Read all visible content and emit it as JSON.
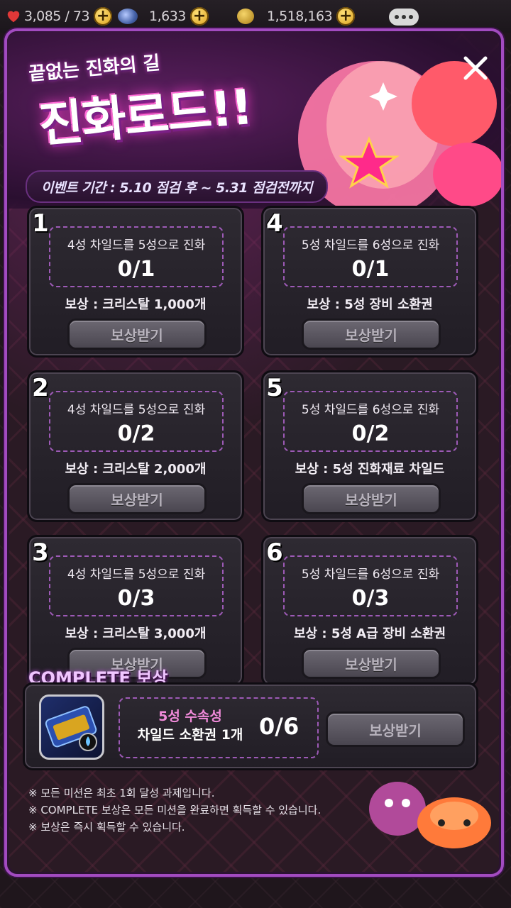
{
  "topbar": {
    "hearts": "3,085 / 73",
    "gems": "1,633",
    "gold": "1,518,163"
  },
  "banner": {
    "subtitle": "끝없는 진화의 길",
    "title": "진화로드!!",
    "period": "이벤트 기간 : 5.10 점검 후 ~ 5.31 점검전까지"
  },
  "missions": [
    {
      "num": "1",
      "desc": "4성 차일드를 5성으로 진화",
      "progress": "0/1",
      "reward": "보상 :  크리스탈 1,000개",
      "button": "보상받기"
    },
    {
      "num": "2",
      "desc": "4성 차일드를 5성으로 진화",
      "progress": "0/2",
      "reward": "보상 :  크리스탈 2,000개",
      "button": "보상받기"
    },
    {
      "num": "3",
      "desc": "4성 차일드를 5성으로 진화",
      "progress": "0/3",
      "reward": "보상 :  크리스탈 3,000개",
      "button": "보상받기"
    },
    {
      "num": "4",
      "desc": "5성 차일드를 6성으로 진화",
      "progress": "0/1",
      "reward": "보상 :  5성 장비 소환권",
      "button": "보상받기"
    },
    {
      "num": "5",
      "desc": "5성 차일드를 6성으로 진화",
      "progress": "0/2",
      "reward": "보상 :  5성 진화재료 차일드",
      "button": "보상받기"
    },
    {
      "num": "6",
      "desc": "5성 차일드를 6성으로 진화",
      "progress": "0/3",
      "reward": "보상 :  5성 A급 장비 소환권",
      "button": "보상받기"
    }
  ],
  "complete": {
    "label": "COMPLETE 보상",
    "item_line1": "5성 수속성",
    "item_line2": "차일드 소환권 1개",
    "progress": "0/6",
    "button": "보상받기"
  },
  "notes": [
    "※ 모든 미션은 최초 1회 달성 과제입니다.",
    "※ COMPLETE 보상은 모든 미션을 완료하면 획득할 수 있습니다.",
    "※ 보상은 즉시 획득할 수 있습니다."
  ]
}
